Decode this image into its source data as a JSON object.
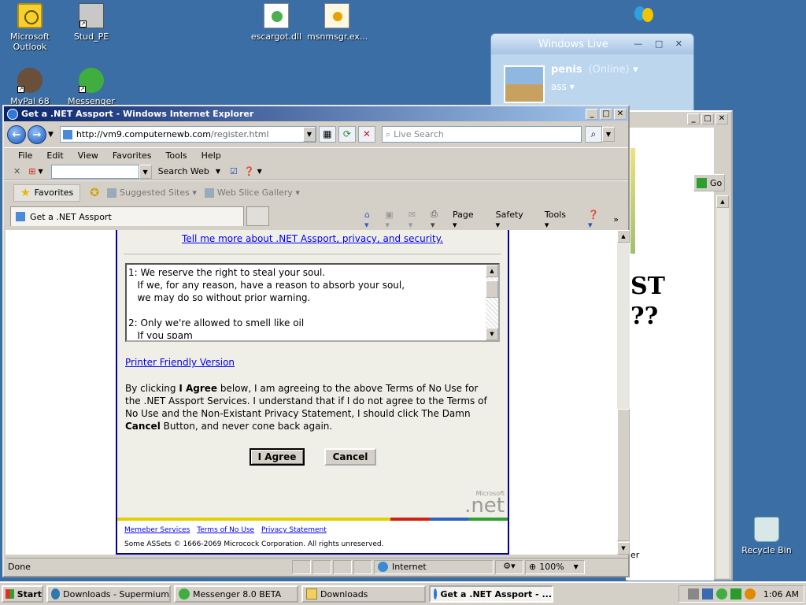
{
  "desktop": {
    "icons": [
      {
        "label": "Microsoft Outlook"
      },
      {
        "label": "Stud_PE"
      },
      {
        "label": "escargot.dll"
      },
      {
        "label": "msnmsgr.ex..."
      },
      {
        "label": "MyPal 68"
      },
      {
        "label": "Messenger"
      },
      {
        "label": "Recycle Bin"
      }
    ]
  },
  "messenger_window": {
    "title": "Windows Live",
    "display_name": "penis",
    "status": "(Online)",
    "personal_message": "ass"
  },
  "back_window": {
    "headline_lines": [
      "ST",
      "??"
    ],
    "go_label": "Go",
    "partial_text": "er"
  },
  "ie": {
    "title": "Get a .NET Assport - Windows Internet Explorer",
    "url_domain": "http://vm9.computernewb.com",
    "url_path": "/register.html",
    "search_placeholder": "Live Search",
    "menu": [
      "File",
      "Edit",
      "View",
      "Favorites",
      "Tools",
      "Help"
    ],
    "toolbar_search_label": "Search Web",
    "favorites_label": "Favorites",
    "suggested_sites": "Suggested Sites",
    "web_slice_gallery": "Web Slice Gallery",
    "tab_label": "Get a .NET Assport",
    "cmd": {
      "page": "Page",
      "safety": "Safety",
      "tools": "Tools"
    },
    "status_text": "Done",
    "zone": "Internet",
    "zoom": "100%"
  },
  "page": {
    "tell_more": "Tell me more about .NET Assport, privacy, and security.",
    "terms_text": "1: We reserve the right to steal your soul.\n   If we, for any reason, have a reason to absorb your soul,\n   we may do so without prior warning.\n\n2: Only we're allowed to smell like oil\n   If you spam",
    "printer_link": "Printer Friendly Version",
    "agree_pre": "By clicking ",
    "agree_bold1": "I Agree",
    "agree_mid": " below, I am agreeing to the above Terms of No Use for the .NET Assport Services. I understand that if I do not agree to the Terms of No Use and the Non-Existant Privacy Statement, I should click The Damn ",
    "agree_bold2": "Cancel",
    "agree_post": " Button, and never cone back again.",
    "agree_button": "I Agree",
    "cancel_button": "Cancel",
    "logo_small": "Microsoft",
    "logo_big": ".net",
    "footer_links": [
      "Memeber Services",
      "Terms of No Use",
      "Privacy Statement"
    ],
    "copyright": "Some ASSets © 1666-2069 Microcock Corporation. All rights unreserved."
  },
  "taskbar": {
    "start": "Start",
    "tasks": [
      {
        "label": "Downloads - Supermium",
        "active": false
      },
      {
        "label": "Messenger 8.0 BETA",
        "active": false
      },
      {
        "label": "Downloads",
        "active": false
      },
      {
        "label": "Get a .NET Assport - ...",
        "active": true
      }
    ],
    "clock": "1:06 AM"
  }
}
